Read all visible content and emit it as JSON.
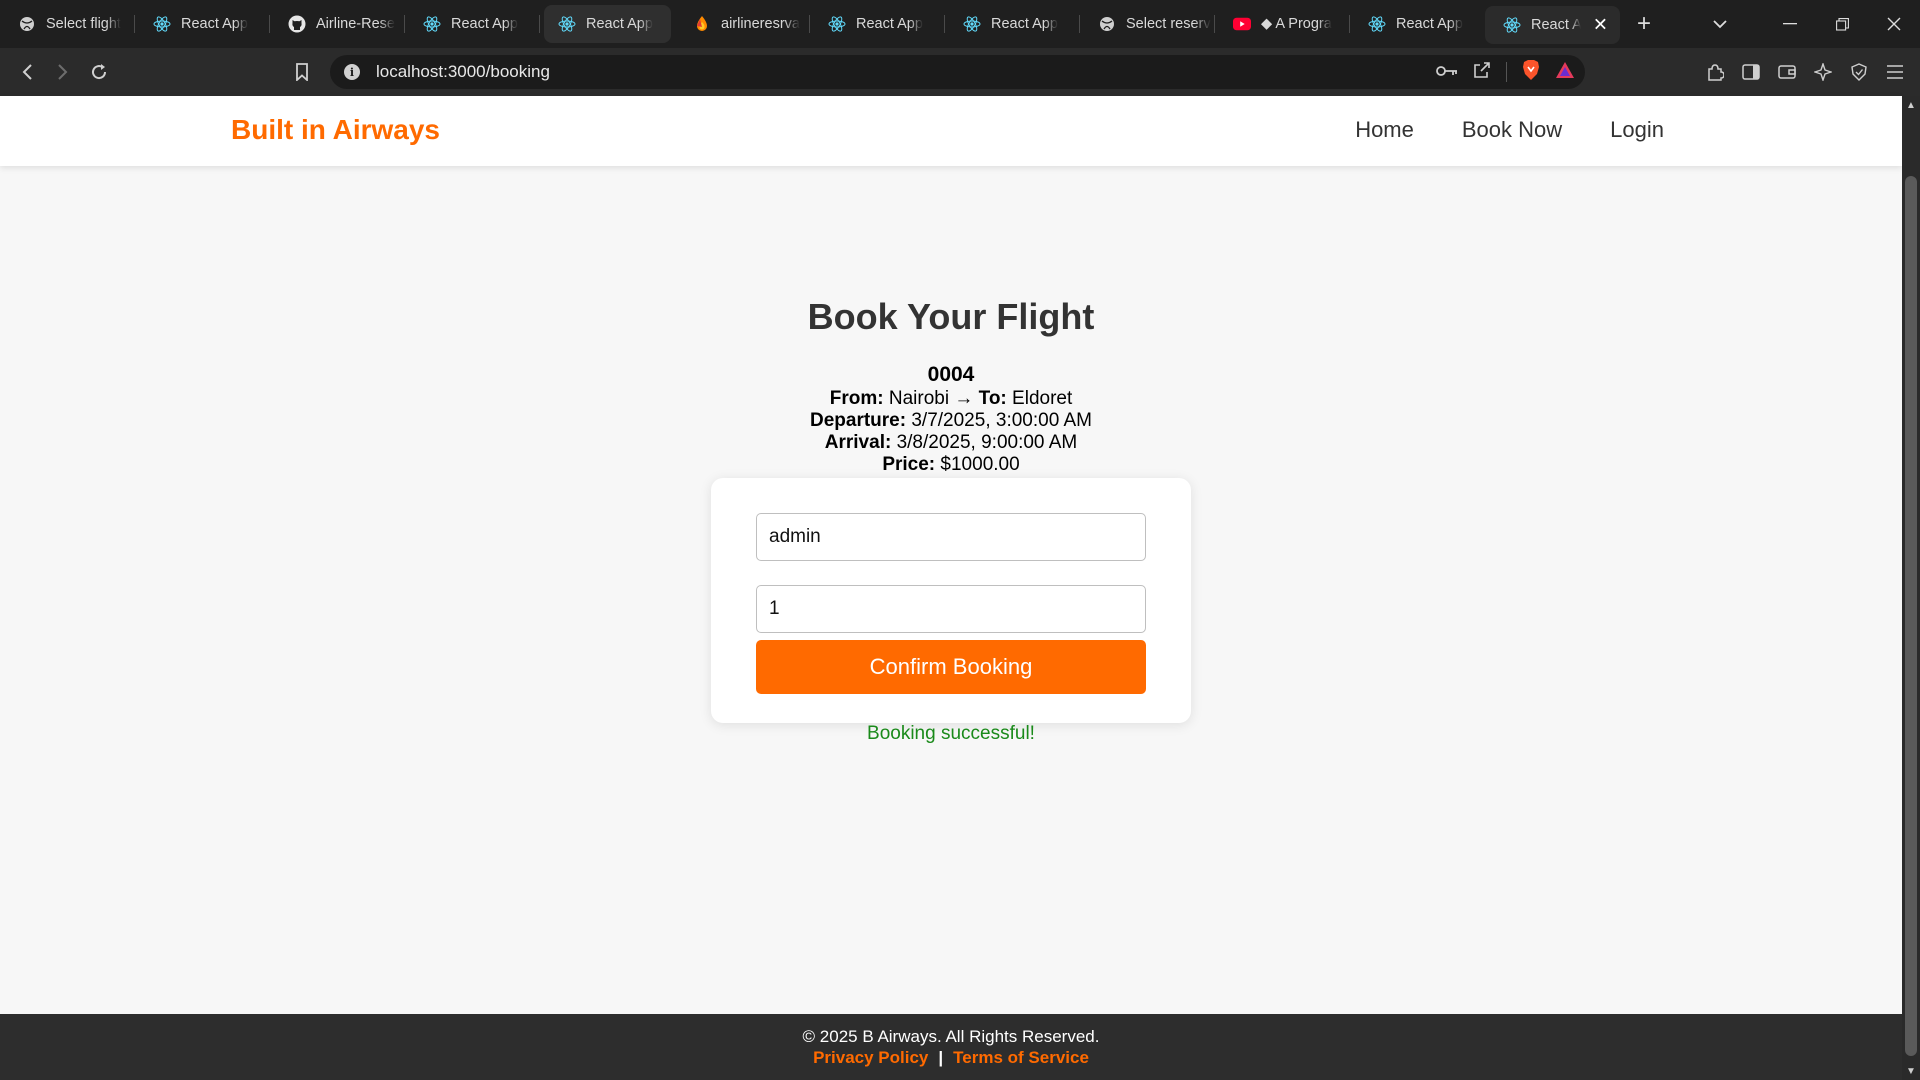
{
  "browser": {
    "tabs": [
      {
        "label": "Select flight",
        "icon": "globe-icon"
      },
      {
        "label": "React App",
        "icon": "react-icon"
      },
      {
        "label": "Airline-Rese",
        "icon": "github-icon"
      },
      {
        "label": "React App",
        "icon": "react-icon"
      },
      {
        "label": "React App",
        "icon": "react-icon"
      },
      {
        "label": "airlineresrva",
        "icon": "firebase-icon"
      },
      {
        "label": "React App",
        "icon": "react-icon"
      },
      {
        "label": "React App",
        "icon": "react-icon"
      },
      {
        "label": "Select reserv",
        "icon": "globe-icon"
      },
      {
        "label": "◆ A Progra",
        "icon": "youtube-icon"
      },
      {
        "label": "React App",
        "icon": "react-icon"
      },
      {
        "label": "React A",
        "icon": "react-icon"
      }
    ],
    "url": "localhost:3000/booking"
  },
  "nav": {
    "brand": "Built in Airways",
    "links": [
      "Home",
      "Book Now",
      "Login"
    ]
  },
  "booking": {
    "title": "Book Your Flight",
    "flight_number": "0004",
    "from_label": "From:",
    "from": "Nairobi",
    "arrow": "→",
    "to_label": "To:",
    "to": "Eldoret",
    "departure_label": "Departure:",
    "departure": "3/7/2025, 3:00:00 AM",
    "arrival_label": "Arrival:",
    "arrival": "3/8/2025, 9:00:00 AM",
    "price_label": "Price:",
    "price": "$1000.00",
    "name_value": "admin",
    "seats_value": "1",
    "confirm_label": "Confirm Booking",
    "status": "Booking successful!"
  },
  "footer": {
    "copyright": "© 2025 B Airways. All Rights Reserved.",
    "privacy": "Privacy Policy",
    "separator": "|",
    "terms": "Terms of Service"
  },
  "colors": {
    "accent": "#ff6a00",
    "success": "#1a8a1a",
    "footer_bg": "#2d2d2d"
  }
}
